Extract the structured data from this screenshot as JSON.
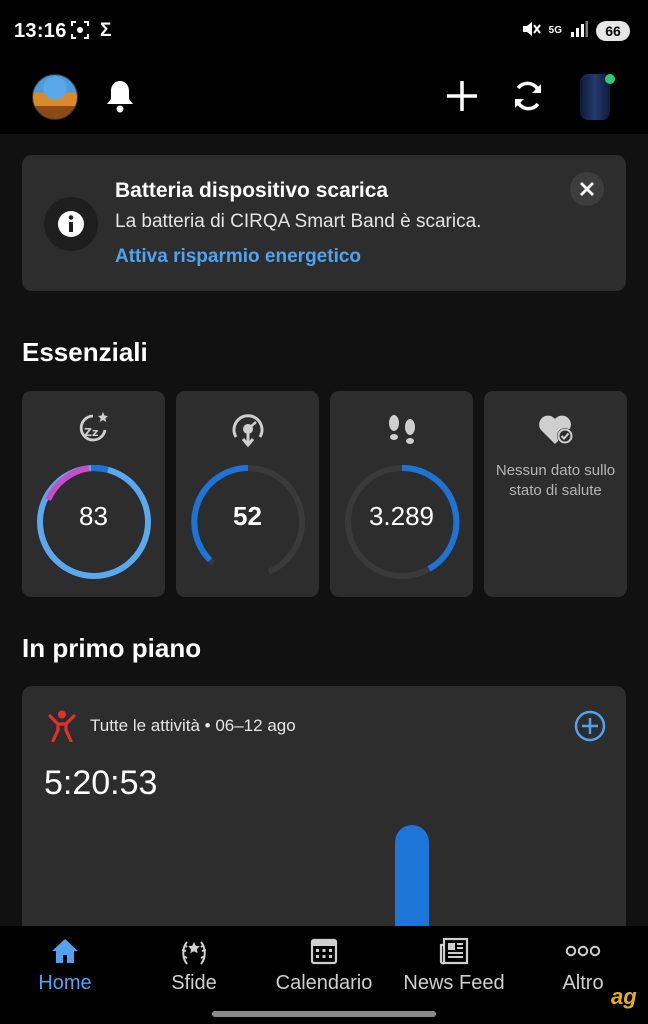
{
  "status_bar": {
    "time": "13:16",
    "left_glyphs": [
      "screen-record-icon",
      "Σ"
    ],
    "sigma": "Σ",
    "network": "5G",
    "battery": "66"
  },
  "header": {
    "icons": [
      "avatar",
      "bell-icon",
      "plus-icon",
      "sync-icon",
      "device-band-icon"
    ]
  },
  "alert": {
    "title": "Batteria dispositivo scarica",
    "body": "La batteria di CIRQA Smart Band è scarica.",
    "link": "Attiva risparmio energetico"
  },
  "essentials": {
    "title": "Essenziali",
    "tiles": [
      {
        "icon": "sleep-icon",
        "value": "83",
        "ring_fraction": 0.83,
        "ring_colors": [
          "#c54fc8",
          "#1e73d6",
          "#5aa9ef"
        ]
      },
      {
        "icon": "stress-icon",
        "value": "52",
        "ring_fraction": 0.52,
        "ring_color": "#1e73d6"
      },
      {
        "icon": "steps-icon",
        "value": "3.289",
        "ring_fraction": 0.45,
        "ring_color": "#1e73d6"
      },
      {
        "icon": "health-status-icon",
        "message": "Nessun dato sullo stato di salute"
      }
    ]
  },
  "featured": {
    "title": "In primo piano",
    "activity_label": "Tutte le attività • 06–12 ago",
    "total_time": "5:20:53"
  },
  "bottom_nav": [
    {
      "label": "Home",
      "icon": "home-icon",
      "active": true
    },
    {
      "label": "Sfide",
      "icon": "laurel-icon",
      "active": false
    },
    {
      "label": "Calendario",
      "icon": "calendar-icon",
      "active": false
    },
    {
      "label": "News Feed",
      "icon": "news-icon",
      "active": false
    },
    {
      "label": "Altro",
      "icon": "more-icon",
      "active": false
    }
  ],
  "colors": {
    "accent": "#4fa3ef",
    "ring_blue": "#1e73d6",
    "ring_light_blue": "#5aa9ef",
    "ring_purple": "#c54fc8",
    "card_bg": "#2d2d2d"
  }
}
